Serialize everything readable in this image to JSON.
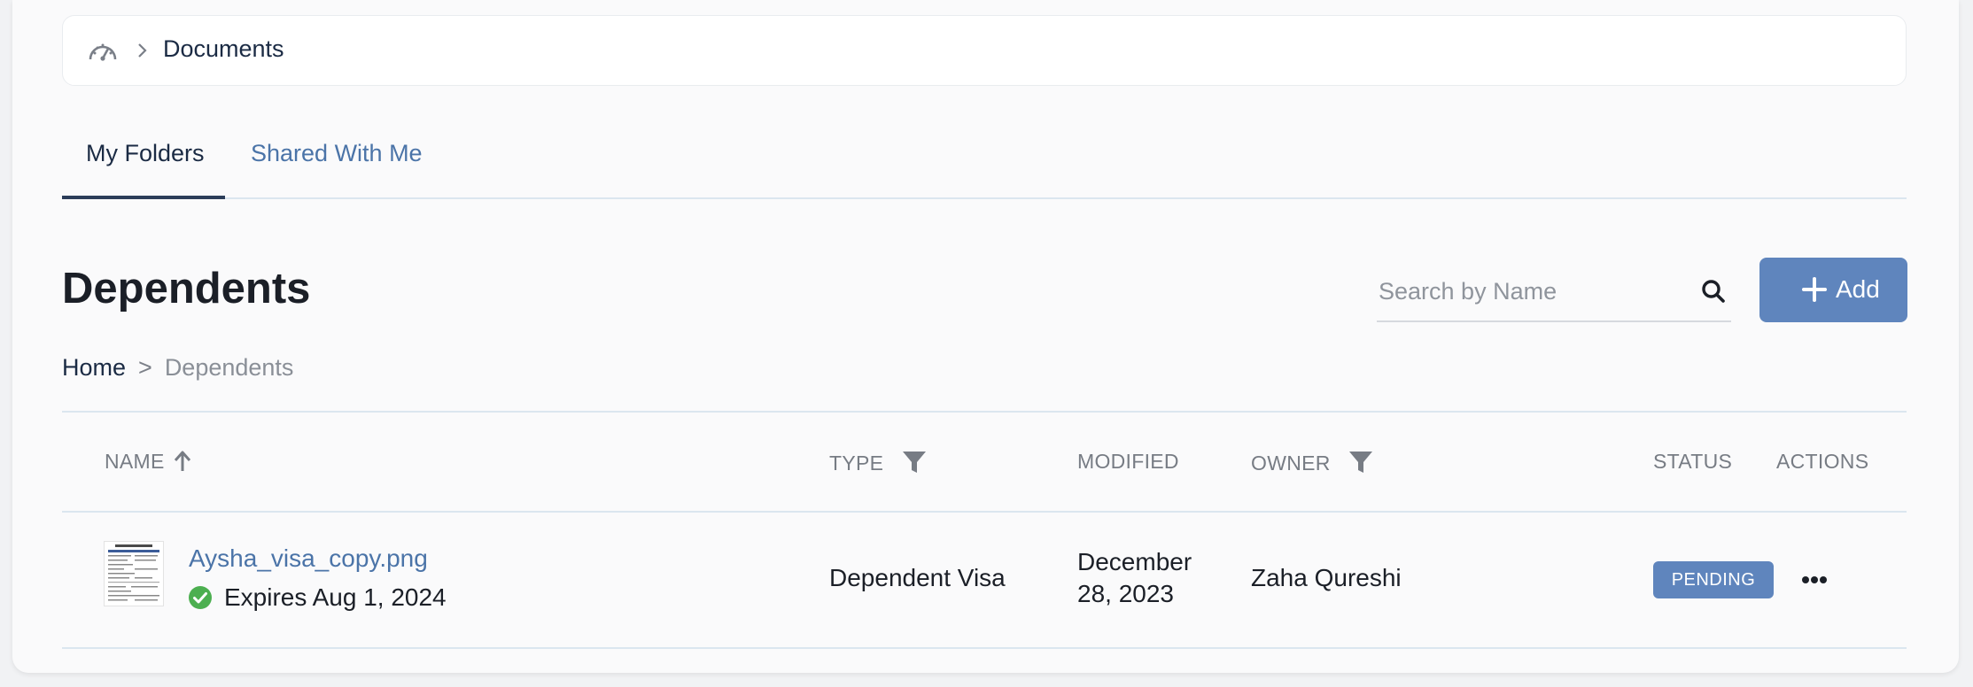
{
  "topbar": {
    "title": "Documents"
  },
  "tabs": [
    {
      "label": "My Folders",
      "active": true
    },
    {
      "label": "Shared With Me",
      "active": false
    }
  ],
  "page": {
    "title": "Dependents"
  },
  "search": {
    "placeholder": "Search by Name",
    "value": ""
  },
  "add_button": {
    "label": "Add"
  },
  "breadcrumb": {
    "home": "Home",
    "separator": ">",
    "current": "Dependents"
  },
  "table": {
    "columns": {
      "name": "NAME",
      "type": "TYPE",
      "modified": "MODIFIED",
      "owner": "OWNER",
      "status": "STATUS",
      "actions": "ACTIONS"
    },
    "rows": [
      {
        "name": "Aysha_visa_copy.png",
        "expiry": "Expires Aug 1, 2024",
        "type": "Dependent Visa",
        "modified_line1": "December",
        "modified_line2": "28, 2023",
        "owner": "Zaha Qureshi",
        "status": "PENDING"
      }
    ]
  },
  "colors": {
    "accent": "#5f85bd",
    "link": "#4b74a8",
    "success": "#4caf50",
    "divider": "#dbe6ef"
  },
  "icons": {
    "topbar": "dashboard-gauge-icon",
    "search": "search-icon",
    "add": "plus-icon",
    "sort": "arrow-up-icon",
    "filter": "filter-icon",
    "status_ok": "check-circle-icon",
    "row_menu": "more-horizontal-icon"
  }
}
